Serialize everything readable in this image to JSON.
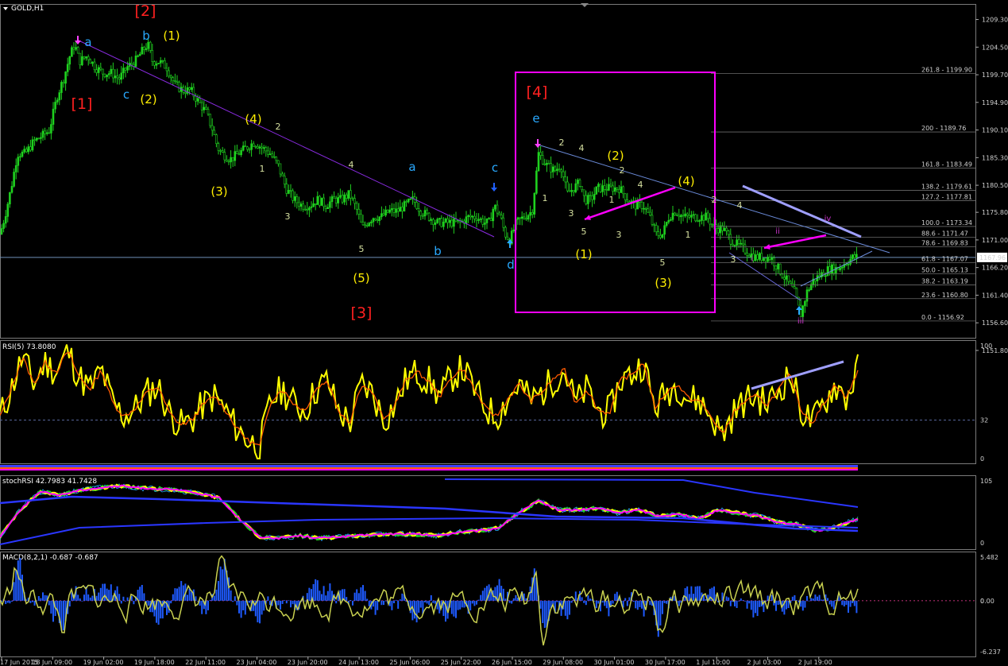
{
  "window": {
    "symbol_title": "GOLD,H1"
  },
  "colors": {
    "background": "#000000",
    "grid": "#2c3a4c",
    "candle": "#1fd11f",
    "rsi_line": "#ffff00",
    "rsi_signal": "#ff5a00",
    "stoch_k": "#ffff00",
    "stoch_d": "#ff00ff",
    "macd_hist": "#1e5aff",
    "macd_signal": "#c8d050",
    "wave_blue": "#29a9ff",
    "wave_yellow": "#ffee00",
    "wave_red": "#ff2020",
    "wave_box": "#ff00ff",
    "trend_lavender": "#9f9fff"
  },
  "chart_data": [
    {
      "type": "candlestick",
      "title": "GOLD,H1",
      "ylim": [
        1154.0,
        1212.0
      ],
      "price_ticks": [
        "1209.30",
        "1204.50",
        "1199.70",
        "1194.90",
        "1190.10",
        "1185.30",
        "1180.50",
        "1175.80",
        "1171.00",
        "1166.20",
        "1161.40",
        "1156.60",
        "1151.80"
      ],
      "current_price": "1167.96",
      "x_time_labels": [
        "17 Jun 2015",
        "18 Jun 09:00",
        "19 Jun 02:00",
        "19 Jun 18:00",
        "22 Jun 11:00",
        "23 Jun 04:00",
        "23 Jun 20:00",
        "24 Jun 13:00",
        "25 Jun 06:00",
        "25 Jun 22:00",
        "26 Jun 15:00",
        "29 Jun 08:00",
        "30 Jun 01:00",
        "30 Jun 17:00",
        "1 Jul 10:00",
        "2 Jul 03:00",
        "2 Jul 19:00"
      ],
      "price_path": [
        [
          0,
          1172
        ],
        [
          6,
          1175
        ],
        [
          14,
          1180
        ],
        [
          22,
          1186
        ],
        [
          32,
          1186
        ],
        [
          42,
          1188
        ],
        [
          52,
          1189
        ],
        [
          62,
          1190
        ],
        [
          72,
          1196
        ],
        [
          80,
          1199
        ],
        [
          88,
          1203
        ],
        [
          94,
          1205
        ],
        [
          100,
          1202
        ],
        [
          110,
          1203
        ],
        [
          120,
          1201
        ],
        [
          130,
          1200
        ],
        [
          140,
          1200
        ],
        [
          150,
          1199
        ],
        [
          160,
          1201
        ],
        [
          170,
          1202
        ],
        [
          180,
          1204
        ],
        [
          186,
          1205
        ],
        [
          192,
          1202
        ],
        [
          200,
          1202
        ],
        [
          210,
          1201
        ],
        [
          220,
          1198
        ],
        [
          230,
          1197
        ],
        [
          240,
          1197
        ],
        [
          250,
          1195
        ],
        [
          260,
          1193
        ],
        [
          268,
          1190
        ],
        [
          274,
          1187
        ],
        [
          280,
          1186
        ],
        [
          290,
          1185
        ],
        [
          300,
          1186
        ],
        [
          310,
          1187
        ],
        [
          320,
          1188
        ],
        [
          330,
          1187
        ],
        [
          340,
          1186
        ],
        [
          350,
          1184
        ],
        [
          360,
          1180
        ],
        [
          370,
          1178
        ],
        [
          380,
          1177
        ],
        [
          390,
          1177
        ],
        [
          400,
          1178
        ],
        [
          410,
          1177
        ],
        [
          420,
          1178
        ],
        [
          430,
          1178
        ],
        [
          440,
          1179
        ],
        [
          450,
          1176
        ],
        [
          456,
          1173
        ],
        [
          462,
          1174
        ],
        [
          470,
          1175
        ],
        [
          480,
          1175
        ],
        [
          490,
          1176
        ],
        [
          500,
          1176
        ],
        [
          510,
          1177
        ],
        [
          520,
          1178
        ],
        [
          530,
          1176
        ],
        [
          540,
          1175
        ],
        [
          550,
          1174
        ],
        [
          560,
          1174
        ],
        [
          570,
          1174
        ],
        [
          580,
          1174
        ],
        [
          590,
          1175
        ],
        [
          600,
          1175
        ],
        [
          610,
          1174
        ],
        [
          616,
          1174
        ],
        [
          622,
          1177
        ],
        [
          630,
          1175
        ],
        [
          636,
          1172
        ],
        [
          642,
          1171
        ],
        [
          650,
          1174
        ],
        [
          660,
          1175
        ],
        [
          670,
          1176
        ],
        [
          678,
          1186
        ],
        [
          688,
          1184
        ],
        [
          698,
          1183
        ],
        [
          706,
          1184
        ],
        [
          714,
          1179
        ],
        [
          722,
          1180
        ],
        [
          730,
          1181
        ],
        [
          736,
          1178
        ],
        [
          744,
          1178
        ],
        [
          752,
          1180
        ],
        [
          760,
          1180
        ],
        [
          770,
          1180
        ],
        [
          780,
          1180
        ],
        [
          790,
          1178
        ],
        [
          800,
          1177
        ],
        [
          810,
          1177
        ],
        [
          818,
          1175
        ],
        [
          826,
          1172
        ],
        [
          834,
          1172
        ],
        [
          842,
          1175
        ],
        [
          850,
          1176
        ],
        [
          860,
          1175
        ],
        [
          870,
          1175
        ],
        [
          880,
          1175
        ],
        [
          890,
          1175
        ],
        [
          900,
          1173
        ],
        [
          910,
          1173
        ],
        [
          920,
          1171
        ],
        [
          930,
          1170
        ],
        [
          940,
          1169
        ],
        [
          950,
          1168
        ],
        [
          960,
          1168
        ],
        [
          970,
          1168
        ],
        [
          980,
          1166
        ],
        [
          990,
          1164
        ],
        [
          1000,
          1162
        ],
        [
          1008,
          1158
        ],
        [
          1016,
          1162
        ],
        [
          1024,
          1164
        ],
        [
          1034,
          1165
        ],
        [
          1044,
          1166
        ],
        [
          1054,
          1166
        ],
        [
          1064,
          1167
        ],
        [
          1074,
          1168
        ],
        [
          1080,
          1168
        ]
      ],
      "fibonacci": [
        {
          "ratio": "261.8",
          "price": "1199.90"
        },
        {
          "ratio": "200",
          "price": "1189.76"
        },
        {
          "ratio": "161.8",
          "price": "1183.49"
        },
        {
          "ratio": "138.2",
          "price": "1179.61"
        },
        {
          "ratio": "127.2",
          "price": "1177.81"
        },
        {
          "ratio": "100.0",
          "price": "1173.34"
        },
        {
          "ratio": "88.6",
          "price": "1171.47"
        },
        {
          "ratio": "78.6",
          "price": "1169.83"
        },
        {
          "ratio": "61.8",
          "price": "1167.07"
        },
        {
          "ratio": "50.0",
          "price": "1165.13"
        },
        {
          "ratio": "38.2",
          "price": "1163.19"
        },
        {
          "ratio": "23.6",
          "price": "1160.80"
        },
        {
          "ratio": "0.0",
          "price": "1156.92"
        }
      ],
      "wave_labels": {
        "red": [
          "[1]",
          "[2]",
          "[3]",
          "[4]"
        ],
        "yellow": [
          "(1)",
          "(2)",
          "(3)",
          "(4)",
          "(5)",
          "(1)",
          "(2)",
          "(3)",
          "(4)"
        ],
        "blue": [
          "a",
          "b",
          "c",
          "a",
          "b",
          "c",
          "d",
          "e"
        ],
        "minor": [
          "1",
          "2",
          "3",
          "4",
          "5",
          "1",
          "2",
          "3",
          "4",
          "5",
          "1",
          "2",
          "3",
          "4",
          "5",
          "1",
          "3",
          "i",
          "ii",
          "iii",
          "iv"
        ]
      }
    },
    {
      "type": "line",
      "title": "RSI(5) 73.8080",
      "ylim": [
        0,
        100
      ],
      "levels": [
        "100",
        "32",
        "0"
      ],
      "series": [
        {
          "name": "RSI(5)",
          "values": [
            35,
            58,
            85,
            62,
            80,
            72,
            90,
            68,
            58,
            74,
            46,
            35,
            42,
            55,
            60,
            38,
            28,
            32,
            45,
            52,
            40,
            25,
            15,
            10,
            48,
            58,
            46,
            40,
            58,
            65,
            40,
            30,
            62,
            55,
            32,
            45,
            66,
            72,
            64,
            52,
            68,
            75,
            58,
            42,
            35,
            50,
            62,
            48,
            55,
            66,
            74,
            46,
            58,
            40,
            38,
            66,
            70,
            80,
            42,
            55,
            62,
            50,
            48,
            35,
            20,
            38,
            48,
            52,
            45,
            58,
            70,
            40,
            30,
            46,
            62,
            50,
            74
          ]
        }
      ]
    },
    {
      "type": "line",
      "title": "stochRSI 42.7983 41.7428",
      "ylim": [
        0,
        105
      ],
      "levels": [
        "105",
        "0"
      ],
      "series": [
        {
          "name": "stochRSI",
          "values": [
            10,
            55,
            85,
            80,
            88,
            92,
            95,
            92,
            90,
            88,
            82,
            75,
            40,
            10,
            8,
            12,
            8,
            10,
            12,
            14,
            15,
            14,
            12,
            18,
            20,
            25,
            50,
            70,
            55,
            55,
            58,
            50,
            55,
            45,
            48,
            40,
            55,
            50,
            45,
            35,
            30,
            20,
            28,
            40
          ]
        }
      ]
    },
    {
      "type": "bar",
      "title": "MACD(8,2,1) -0.687 -0.687",
      "ylim": [
        -6.237,
        5.482
      ],
      "levels": [
        "5.482",
        "0.00",
        "0",
        "-6.237"
      ]
    }
  ]
}
